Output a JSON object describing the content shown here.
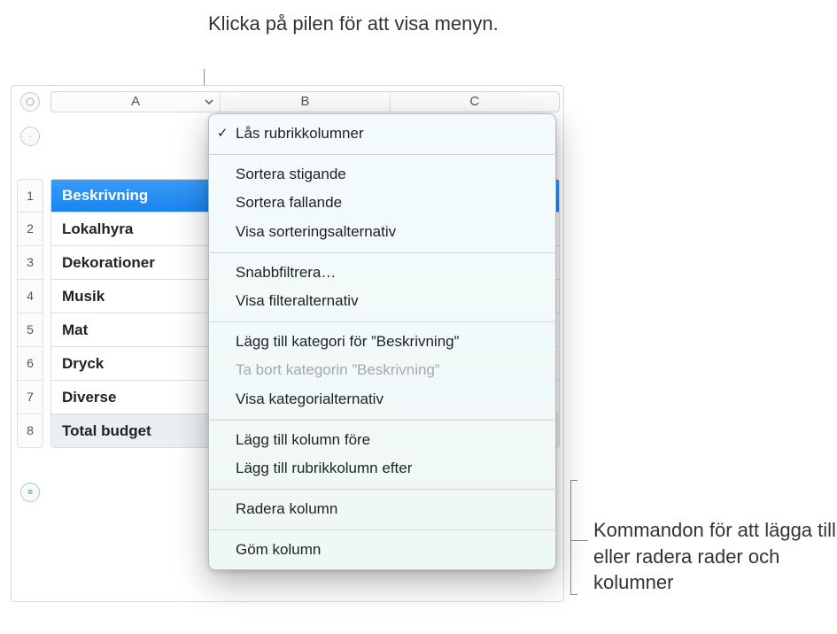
{
  "callouts": {
    "top": "Klicka på pilen för att visa menyn.",
    "right": "Kommandon för att lägga till eller radera rader och kolumner"
  },
  "columns": {
    "a": "A",
    "b": "B",
    "c": "C"
  },
  "row_numbers": [
    "1",
    "2",
    "3",
    "4",
    "5",
    "6",
    "7",
    "8"
  ],
  "table_rows": {
    "r1": "Beskrivning",
    "r2": "Lokalhyra",
    "r3": "Dekorationer",
    "r4": "Musik",
    "r5": "Mat",
    "r6": "Dryck",
    "r7": "Diverse",
    "r8": "Total budget"
  },
  "menu": {
    "lock_header_columns": "Lås rubrikkolumner",
    "sort_ascending": "Sortera stigande",
    "sort_descending": "Sortera fallande",
    "show_sort_options": "Visa sorteringsalternativ",
    "quick_filter": "Snabbfiltrera…",
    "show_filter_options": "Visa filteralternativ",
    "add_category_for": "Lägg till kategori för ”Beskrivning”",
    "remove_category": "Ta bort kategorin ”Beskrivning”",
    "show_category_options": "Visa kategorialternativ",
    "add_column_before": "Lägg till kolumn före",
    "add_header_column_after": "Lägg till rubrikkolumn efter",
    "delete_column": "Radera kolumn",
    "hide_column": "Göm kolumn"
  },
  "icons": {
    "check": "✓"
  }
}
